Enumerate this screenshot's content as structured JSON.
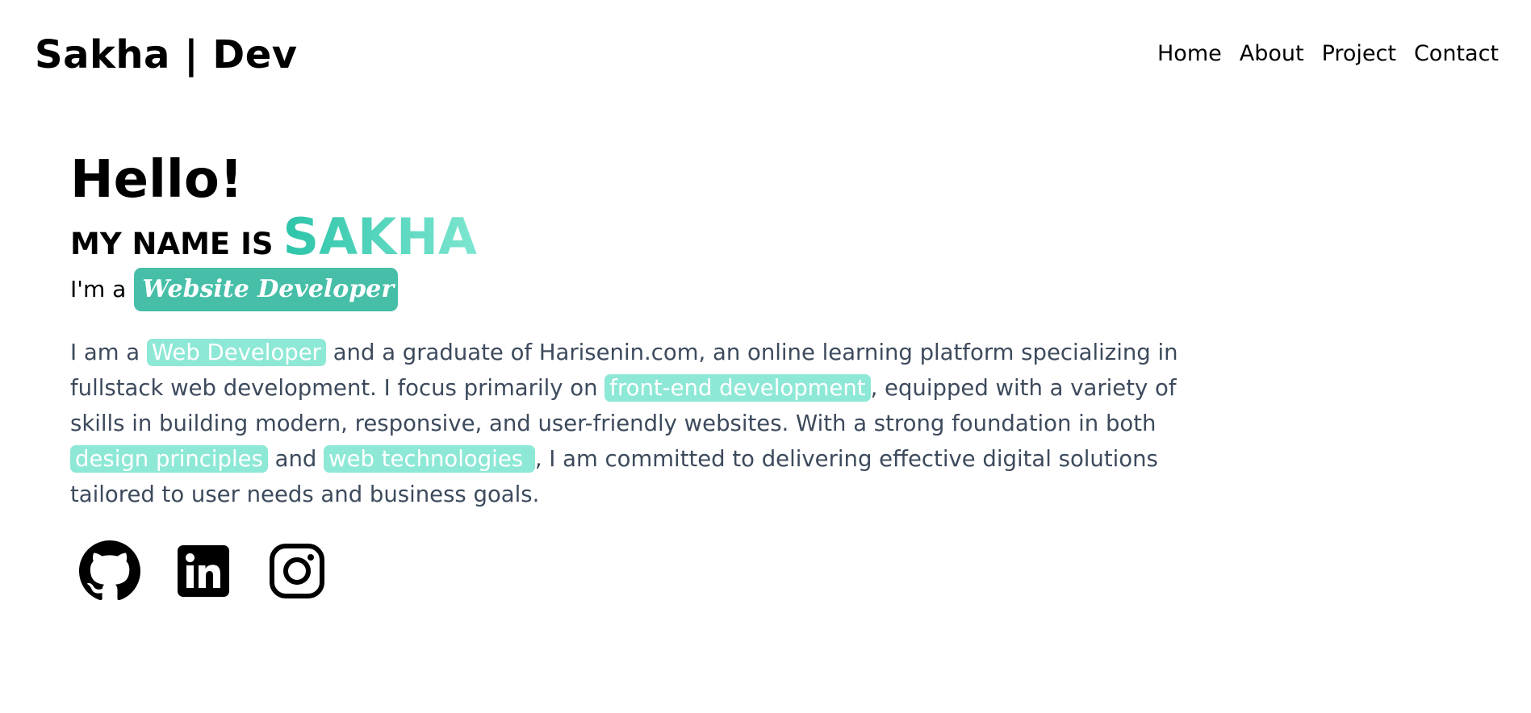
{
  "nav": {
    "brand": "Sakha | Dev",
    "links": [
      "Home",
      "About",
      "Project",
      "Contact"
    ]
  },
  "hero": {
    "greeting": "Hello!",
    "name_prefix": "MY NAME IS",
    "name": "SAKHA",
    "role_prefix": "I'm a",
    "role": "Website Developer"
  },
  "bio": {
    "t1": "I am a ",
    "h1": "Web Developer",
    "t2": " and a graduate of Harisenin.com, an online learning platform specializing in fullstack web development. I focus primarily on ",
    "h2": "front-end development",
    "t3": ", equipped with a variety of skills in building modern, responsive, and user-friendly websites. With a strong foundation in both ",
    "h3": "design principles",
    "t4": " and ",
    "h4": "web technologies ",
    "t5": ", I am committed to delivering effective digital solutions tailored to user needs and business goals."
  },
  "socials": [
    "github-icon",
    "linkedin-icon",
    "instagram-icon"
  ],
  "colors": {
    "accent": "#47bfa8",
    "gradient_start": "#2cc4a9",
    "gradient_end": "#7ee6d0",
    "highlight": "#8ee8d6",
    "body_text": "#3d4a5c"
  }
}
